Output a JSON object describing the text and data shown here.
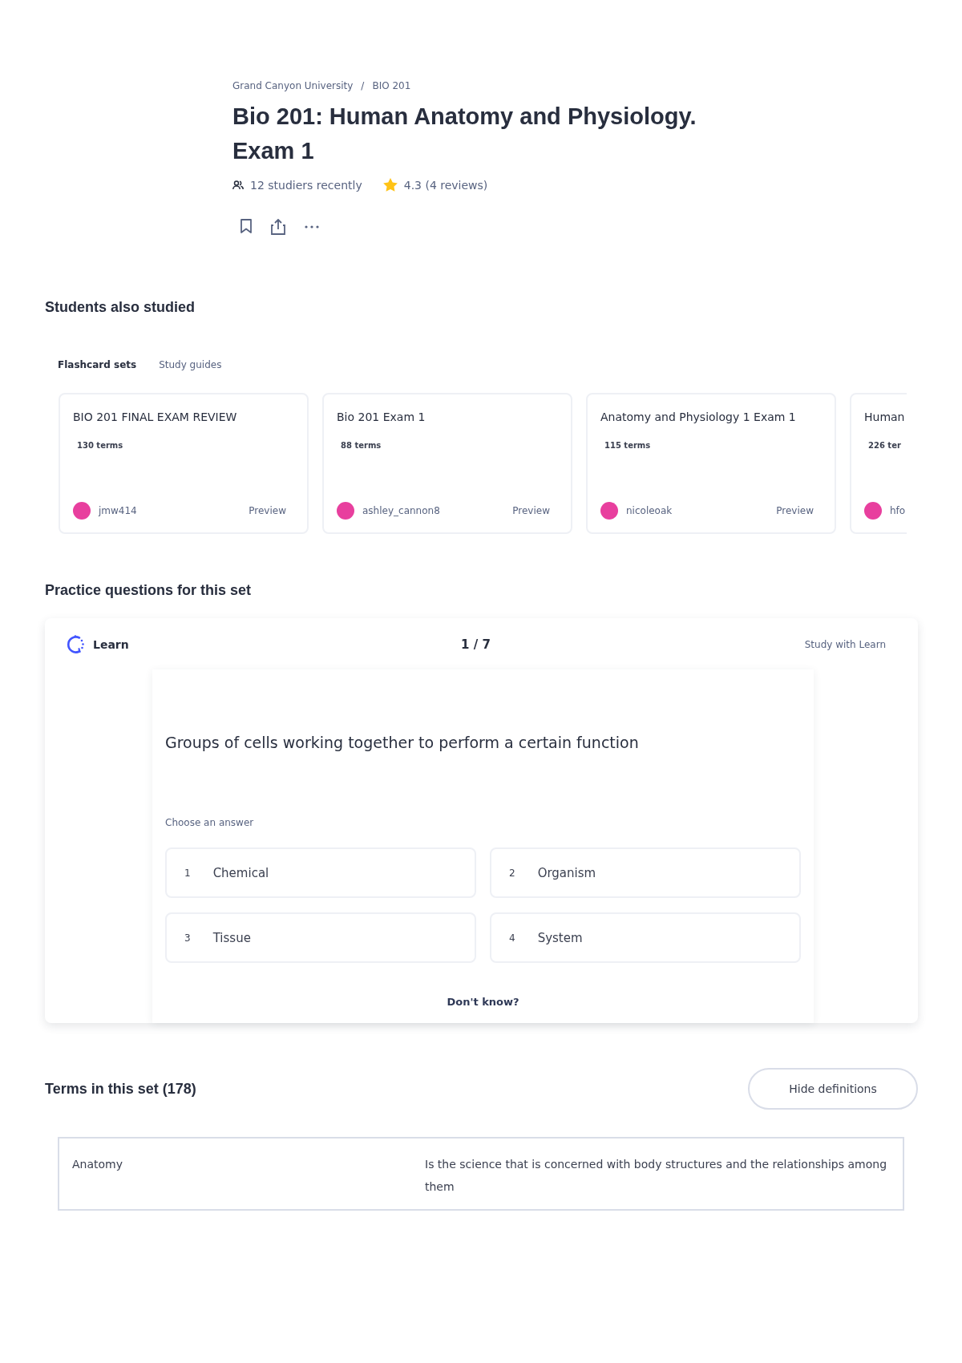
{
  "breadcrumb": [
    "Grand Canyon University",
    "BIO 201"
  ],
  "breadcrumb_separator": "/",
  "title": "Bio 201: Human Anatomy and Physiology. Exam 1",
  "meta": {
    "studiers": "12 studiers recently",
    "rating": "4.3 (4 reviews)"
  },
  "also_studied": {
    "heading": "Students also studied",
    "tabs": [
      {
        "label": "Flashcard sets",
        "selected": true
      },
      {
        "label": "Study guides",
        "selected": false
      }
    ],
    "cards": [
      {
        "title": "BIO 201 FINAL EXAM REVIEW",
        "terms": "130 terms",
        "author": "jmw414",
        "action": "Preview"
      },
      {
        "title": "Bio 201 Exam 1",
        "terms": "88 terms",
        "author": "ashley_cannon8",
        "action": "Preview"
      },
      {
        "title": "Anatomy and Physiology 1 Exam 1",
        "terms": "115 terms",
        "author": "nicoleoak",
        "action": "Preview"
      },
      {
        "title": "Human",
        "terms": "226 ter",
        "author": "hfo"
      }
    ]
  },
  "practice": {
    "heading": "Practice questions for this set",
    "mode": "Learn",
    "progress": "1 / 7",
    "study_link": "Study with Learn",
    "question": "Groups of cells working together to perform a certain function",
    "prompt": "Choose an answer",
    "options": [
      {
        "number": "1",
        "text": "Chemical"
      },
      {
        "number": "2",
        "text": "Organism"
      },
      {
        "number": "3",
        "text": "Tissue"
      },
      {
        "number": "4",
        "text": "System"
      }
    ],
    "dont_know": "Don't know?"
  },
  "terms": {
    "heading": "Terms in this set (178)",
    "toggle": "Hide definitions",
    "rows": [
      {
        "term": "Anatomy",
        "definition": "Is the science that is concerned with body structures and the relationships among them"
      }
    ]
  }
}
